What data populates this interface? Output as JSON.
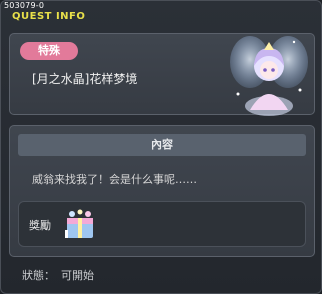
{
  "window": {
    "id_tag": "503079-0",
    "title": "QUEST INFO"
  },
  "quest": {
    "category_tag": "特殊",
    "name": "[月之水晶]花样梦境"
  },
  "content": {
    "header": "內容",
    "text": "威翁来找我了！会是什么事呢……",
    "reward_label": "獎勵",
    "reward_item_icon": "crystal-box-icon"
  },
  "status": {
    "label": "狀態：",
    "value": "可開始"
  },
  "colors": {
    "title": "#e8e04a",
    "tag_bg": "#e27a9a",
    "panel": "#3b4149"
  }
}
